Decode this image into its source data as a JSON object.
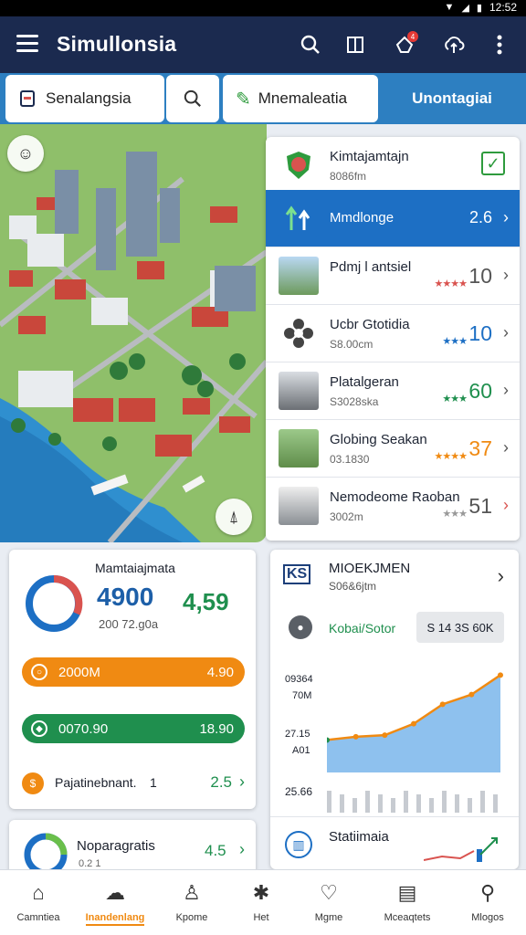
{
  "status_bar": {
    "time": "12:52",
    "icons": [
      "wifi-icon",
      "signal-icon",
      "battery-icon"
    ]
  },
  "app_bar": {
    "title": "Simullonsia",
    "notification_count": "4"
  },
  "toolbar": {
    "dropdown_label": "Senalangsia",
    "tool_label": "Mnemaleatia",
    "active_tab_label": "Unontagiai"
  },
  "list": [
    {
      "name": "Kimtajamtajn",
      "sub": "8086fm",
      "value": "",
      "status": "checked",
      "icon": "shield-crest-icon"
    },
    {
      "name": "Mmdlonge",
      "sub": "",
      "value": "2.6",
      "selected": true,
      "icon": "growth-arrows-icon"
    },
    {
      "name": "Pdmj l antsiel",
      "sub": "",
      "value": "10",
      "stars": "★★★★",
      "star_color": "#d9534f"
    },
    {
      "name": "Ucbr Gtotidia",
      "sub": "S8.00cm",
      "value": "10",
      "stars": "★★★",
      "star_color": "#1d6fc4"
    },
    {
      "name": "Platalgeran",
      "sub": "S3028ska",
      "value": "60",
      "stars": "★★★",
      "star_color": "#1f8f4e"
    },
    {
      "name": "Globing Seakan",
      "sub": "03.1830",
      "value": "37",
      "stars": "★★★★",
      "star_color": "#f08a12"
    },
    {
      "name": "Nemodeome Raoban",
      "sub": "3002m",
      "value": "51",
      "stars": "★★★",
      "star_color": "#999999"
    }
  ],
  "stats_card": {
    "title": "Mamtaiajmata",
    "big_value": "4900",
    "big_secondary": "4,59",
    "sub_value": "200 72.g0a",
    "rows": [
      {
        "label": "2000M",
        "value": "4.90",
        "color": "#f08a12"
      },
      {
        "label": "0070.90",
        "value": "18.90",
        "color": "#1f8f4e"
      }
    ],
    "footer_label": "Pajatinebnant.",
    "footer_count": "1",
    "footer_value": "2.5"
  },
  "mini_card": {
    "title": "Noparagratis",
    "sub": "0.2 1",
    "value": "4.5"
  },
  "chart_card": {
    "title": "MIOEKJMEN",
    "subtitle": "S06&6jtm",
    "green_label": "Kobai/Sotor",
    "button_label": "S 14 3S 60K"
  },
  "chart_data": {
    "type": "area",
    "y_tick_labels": [
      "09364",
      "70M",
      "27.15",
      "A01",
      "25.66"
    ],
    "x": [
      0,
      1,
      2,
      3,
      4,
      5,
      6
    ],
    "series": [
      {
        "values": [
          10,
          11,
          11.5,
          15,
          21,
          24,
          30
        ]
      }
    ],
    "ylim": [
      0,
      36
    ],
    "colors": {
      "line": "#f08a12",
      "fill": "#8ec1ee",
      "points": "#1f8f4e"
    }
  },
  "stat_card": {
    "title": "Statiimaia"
  },
  "bottom_nav": [
    {
      "label": "Camntiea",
      "icon": "home-icon"
    },
    {
      "label": "Inandenlang",
      "icon": "group-icon",
      "active": true
    },
    {
      "label": "Kpome",
      "icon": "person-icon"
    },
    {
      "label": "Het",
      "icon": "compass-icon"
    },
    {
      "label": "Mgme",
      "icon": "map-icon"
    },
    {
      "label": "Mceaqtets",
      "icon": "book-icon"
    },
    {
      "label": "Mlogos",
      "icon": "profile-icon"
    }
  ]
}
